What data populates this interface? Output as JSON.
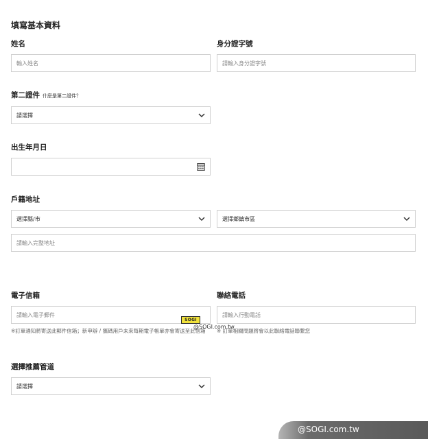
{
  "form": {
    "heading": "填寫基本資料",
    "name": {
      "label": "姓名",
      "placeholder": "輸入姓名"
    },
    "id_number": {
      "label": "身分證字號",
      "placeholder": "請輸入身分證字號"
    },
    "second_id": {
      "label": "第二證件",
      "hint": "什麼是第二證件？",
      "value": "請選擇"
    },
    "birthdate": {
      "label": "出生年月日",
      "value": ""
    },
    "address": {
      "label": "戶籍地址",
      "county_value": "選擇縣/市",
      "district_value": "選擇鄉鎮市區",
      "full_placeholder": "請輸入完整地址"
    },
    "email": {
      "label": "電子信箱",
      "placeholder": "請輸入電子郵件",
      "note": "※訂單通知將寄送此郵件信箱；新申辦 / 攜碼用戶未來每期電子帳單亦會寄送至此信箱"
    },
    "phone": {
      "label": "聯絡電話",
      "placeholder": "請輸入行動電話",
      "note": "※ 訂單相關問題將會以此聯絡電話聯繫您"
    },
    "referral": {
      "label": "選擇推薦管道",
      "value": "請選擇"
    }
  },
  "watermark": {
    "center_logo": "SOGI",
    "center_url": "@SOGI.com.tw",
    "corner_text": "@SOGI.com.tw"
  },
  "colors": {
    "border": "#cfcfcf",
    "text": "#222222",
    "placeholder": "#888888"
  },
  "icons": {
    "dropdown": "chevron-down-icon",
    "calendar": "calendar-icon"
  }
}
